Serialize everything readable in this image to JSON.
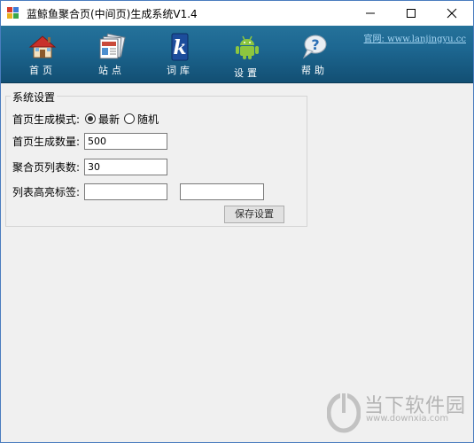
{
  "window": {
    "title": "蓝鲸鱼聚合页(中间页)生成系统V1.4",
    "controls": [
      "minimize",
      "maximize",
      "close"
    ]
  },
  "toolbar": {
    "items": [
      {
        "label": "首页",
        "icon": "home-icon"
      },
      {
        "label": "站点",
        "icon": "sites-icon"
      },
      {
        "label": "词库",
        "icon": "lexicon-icon"
      },
      {
        "label": "设置",
        "icon": "android-settings-icon"
      },
      {
        "label": "帮助",
        "icon": "help-icon"
      }
    ],
    "site_prefix": "官网:",
    "site_url": "www.lanjingyu.cc"
  },
  "settings": {
    "group_title": "系统设置",
    "homepage_mode_label": "首页生成模式:",
    "mode_options": [
      {
        "label": "最新",
        "selected": true
      },
      {
        "label": "随机",
        "selected": false
      }
    ],
    "homepage_count_label": "首页生成数量:",
    "homepage_count": "500",
    "list_count_label": "聚合页列表数:",
    "list_count": "30",
    "highlight_label": "列表高亮标签:",
    "highlight_open": "",
    "highlight_close": "",
    "save_label": "保存设置"
  },
  "watermark": {
    "text": "当下软件园",
    "url": "www.downxia.com"
  },
  "colors": {
    "toolbar": "#1d6791",
    "window_border": "#4a7dbf",
    "background": "#f0f0f0"
  }
}
